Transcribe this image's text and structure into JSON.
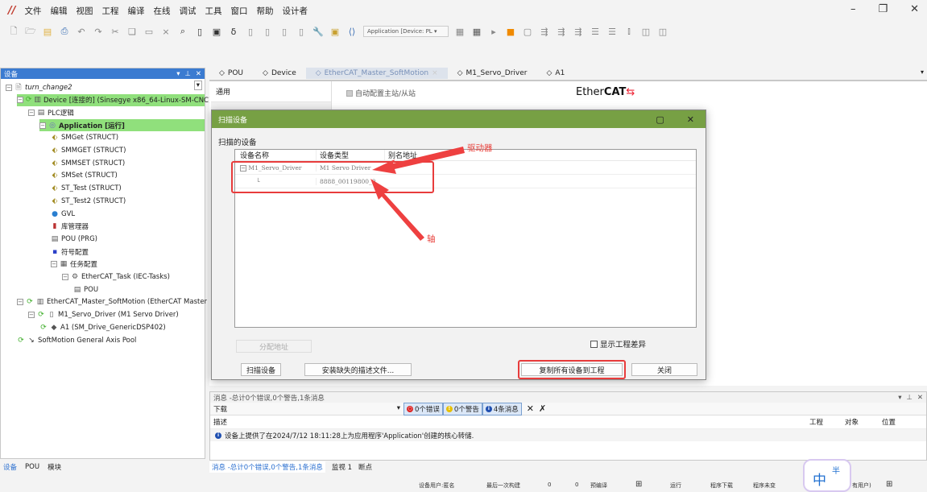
{
  "menu": [
    "文件",
    "编辑",
    "视图",
    "工程",
    "编译",
    "在线",
    "调试",
    "工具",
    "窗口",
    "帮助",
    "设计者"
  ],
  "toolbar": {
    "app_select": "Application [Device: PL"
  },
  "devices_panel": {
    "title": "设备",
    "tree": [
      {
        "label": "turn_change2",
        "level": 0,
        "icon": "project-icon"
      },
      {
        "label": "Device [连接的] (Sinsegye x86_64-Linux-SM-CNC)",
        "level": 1,
        "icon": "device-icon",
        "highlight": true
      },
      {
        "label": "PLC逻辑",
        "level": 2,
        "icon": "plc-logic-icon"
      },
      {
        "label": "Application [运行]",
        "level": 3,
        "icon": "application-icon",
        "highlight": true,
        "bold": true
      },
      {
        "label": "SMGet (STRUCT)",
        "level": 4,
        "icon": "struct-icon"
      },
      {
        "label": "SMMGET (STRUCT)",
        "level": 4,
        "icon": "struct-icon"
      },
      {
        "label": "SMMSET (STRUCT)",
        "level": 4,
        "icon": "struct-icon"
      },
      {
        "label": "SMSet (STRUCT)",
        "level": 4,
        "icon": "struct-icon"
      },
      {
        "label": "ST_Test (STRUCT)",
        "level": 4,
        "icon": "struct-icon"
      },
      {
        "label": "ST_Test2 (STRUCT)",
        "level": 4,
        "icon": "struct-icon"
      },
      {
        "label": "GVL",
        "level": 4,
        "icon": "gvl-icon"
      },
      {
        "label": "库管理器",
        "level": 4,
        "icon": "library-icon"
      },
      {
        "label": "POU (PRG)",
        "level": 4,
        "icon": "pou-icon"
      },
      {
        "label": "符号配置",
        "level": 4,
        "icon": "symbol-config-icon"
      },
      {
        "label": "任务配置",
        "level": 4,
        "icon": "task-config-icon"
      },
      {
        "label": "EtherCAT_Task (IEC-Tasks)",
        "level": 5,
        "icon": "task-icon"
      },
      {
        "label": "POU",
        "level": 6,
        "icon": "pou-icon"
      },
      {
        "label": "EtherCAT_Master_SoftMotion (EtherCAT Master",
        "level": 1,
        "icon": "ethercat-master-icon"
      },
      {
        "label": "M1_Servo_Driver (M1 Servo Driver)",
        "level": 2,
        "icon": "servo-driver-icon"
      },
      {
        "label": "A1 (SM_Drive_GenericDSP402)",
        "level": 3,
        "icon": "axis-icon"
      },
      {
        "label": "SoftMotion General Axis Pool",
        "level": 1,
        "icon": "axis-pool-icon"
      }
    ]
  },
  "left_tabs": [
    "设备",
    "POU",
    "模块"
  ],
  "doc_tabs": [
    "POU",
    "Device",
    "EtherCAT_Master_SoftMotion",
    "M1_Servo_Driver",
    "A1"
  ],
  "editor": {
    "nav": [
      "通用"
    ],
    "auto_config": "自动配置主站/从站",
    "logo_prefix": "Ether",
    "logo_bold": "CAT"
  },
  "dialog": {
    "title": "扫描设备",
    "group": "扫描的设备",
    "columns": [
      "设备名称",
      "设备类型",
      "别名地址"
    ],
    "rows": [
      {
        "name": "M1_Servo_Driver",
        "type": "M1 Servo Driver",
        "alias": ""
      },
      {
        "name": "",
        "type": "8888_00119800_0",
        "alias": ""
      }
    ],
    "assign_address": "分配地址",
    "show_diff": "显示工程差异",
    "scan": "扫描设备",
    "install": "安装缺失的描述文件...",
    "copy_all": "复制所有设备到工程",
    "close": "关闭"
  },
  "annotations": {
    "driver": "驱动器",
    "axis": "轴"
  },
  "messages": {
    "title": "消息 -总计0个错误,0个警告,1条消息",
    "source": "下载",
    "errors": "0个错误",
    "warnings": "0个警告",
    "infos": "4条消息",
    "columns": [
      "描述",
      "工程",
      "对象",
      "位置"
    ],
    "rows": [
      {
        "text": "设备上提供了在2024/7/12 18:11:28上为应用程序'Application'创建的核心转储."
      }
    ]
  },
  "bottom_tabs": [
    "消息 -总计0个错误,0个警告,1条消息",
    "监视 1",
    "断点"
  ],
  "status": [
    "设备用户:匿名",
    "最后一次构建",
    "0",
    "0",
    "预编译",
    "运行",
    "程序下载",
    "程序未变",
    "有用户)"
  ],
  "ime": {
    "main": "中",
    "sub": "半"
  }
}
